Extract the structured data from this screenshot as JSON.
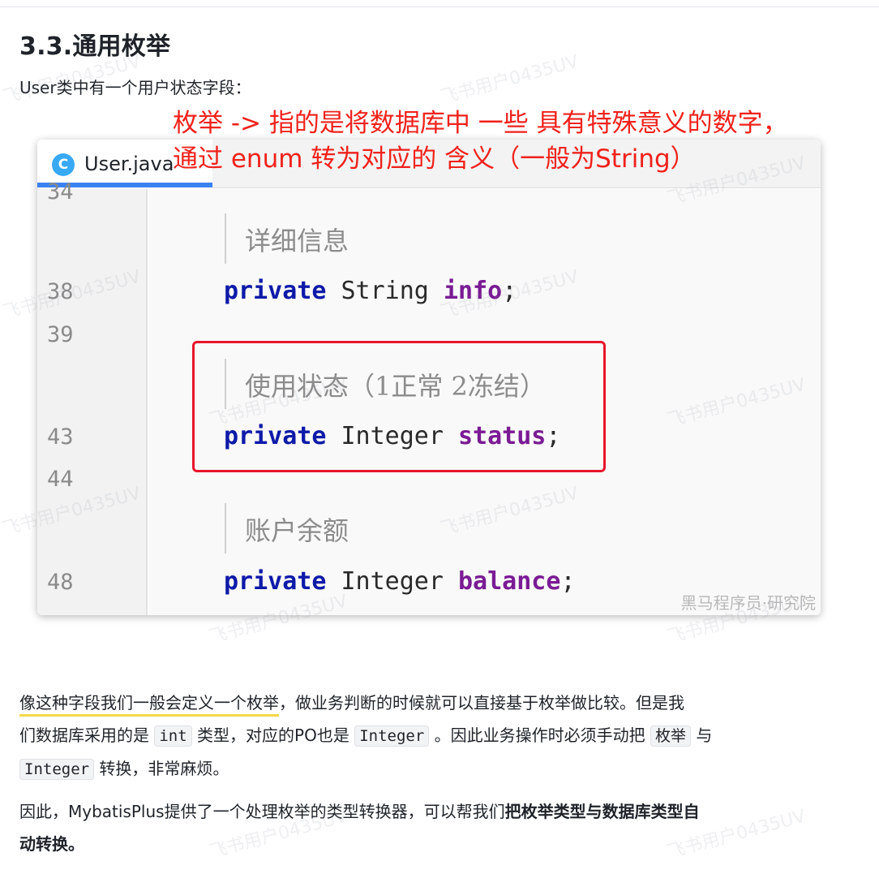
{
  "heading": "3.3.通用枚举",
  "intro": "User类中有一个用户状态字段：",
  "annotation": {
    "line1": "枚举 ->  指的是将数据库中 一些 具有特殊意义的数字，",
    "line2": "通过 enum 转为对应的 含义（一般为String）",
    "color": "#f0211b"
  },
  "screenshot": {
    "tab_label": "User.java",
    "tab_icon_letter": "C",
    "lines": [
      {
        "number": "34"
      },
      {
        "comment": "详细信息"
      },
      {
        "number": "38",
        "keyword": "private",
        "type": "String",
        "field": "info",
        "punct": ";"
      },
      {
        "number": "39"
      },
      {
        "comment": "使用状态（1正常 2冻结）"
      },
      {
        "number": "43",
        "keyword": "private",
        "type": "Integer",
        "field": "status",
        "punct": ";"
      },
      {
        "number": "44"
      },
      {
        "comment": "账户余额"
      },
      {
        "number": "48",
        "keyword": "private",
        "type": "Integer",
        "field": "balance",
        "punct": ";"
      }
    ],
    "image_watermark": "黑马程序员·研究院",
    "highlight_color": "#e8152d"
  },
  "paragraph1": {
    "underlined": "像这种字段我们一般会定义一个枚举",
    "after_underline": "，做业务判断的时候就可以直接基于枚举做比较。但是我",
    "line2_a": "们数据库采用的是 ",
    "code_int": "int",
    "line2_b": " 类型，对应的PO也是 ",
    "code_integer": "Integer",
    "line2_c": " 。因此业务操作时必须手动把 ",
    "code_enum": "枚举",
    "line2_d": " 与",
    "code_integer2": "Integer",
    "line3_tail": " 转换，非常麻烦。"
  },
  "paragraph2": {
    "line1_a": "因此，MybatisPlus提供了一个处理枚举的类型转换器，可以帮我们",
    "line1_bold": "把枚举类型与数据库类型自",
    "line2_bold": "动转换。"
  },
  "watermark": "飞书用户0435UV"
}
